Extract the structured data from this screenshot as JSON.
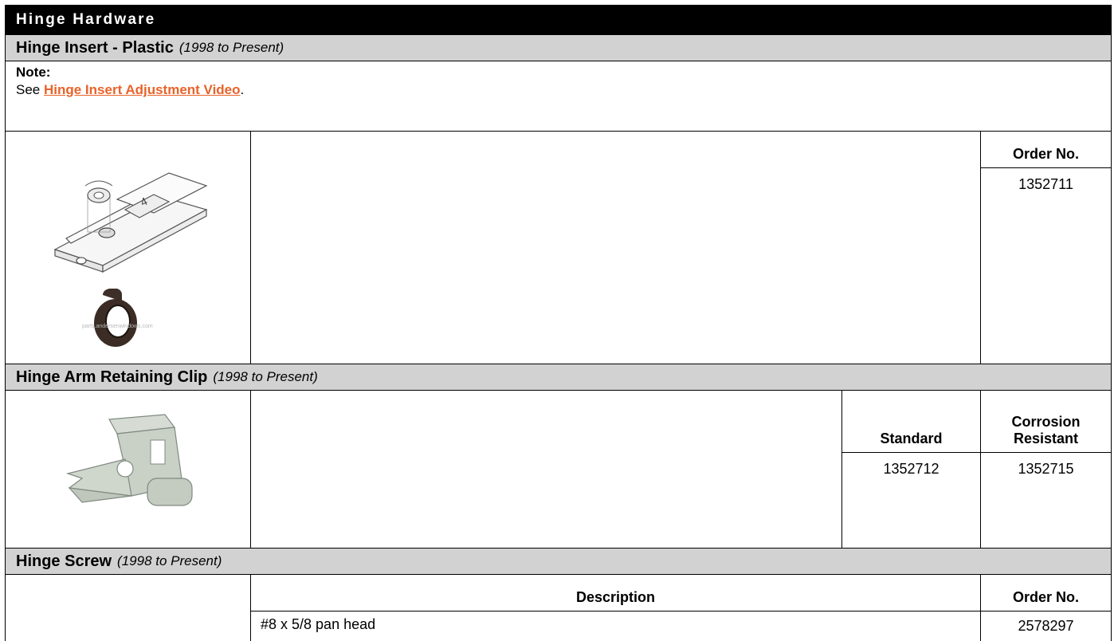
{
  "title": "Hinge Hardware",
  "sections": [
    {
      "name": "Hinge Insert - Plastic",
      "date": "(1998 to Present)",
      "note_label": "Note:",
      "note_prefix": "See ",
      "note_link": "Hinge Insert Adjustment Video",
      "note_suffix": ".",
      "image_watermark": "parts.andersenwindows.com",
      "order_header": "Order No.",
      "order_no": "1352711"
    },
    {
      "name": "Hinge Arm Retaining Clip",
      "date": "(1998 to Present)",
      "col1_header": "Standard",
      "col2_header": "Corrosion Resistant",
      "col1_value": "1352712",
      "col2_value": "1352715"
    },
    {
      "name": "Hinge Screw",
      "date": "(1998 to Present)",
      "desc_header": "Description",
      "order_header": "Order No.",
      "desc_value": "#8 x 5/8 pan head",
      "order_no": "2578297"
    }
  ],
  "colors": {
    "title_bg": "#000000",
    "section_bg": "#d2d2d2",
    "link": "#e8632a"
  }
}
